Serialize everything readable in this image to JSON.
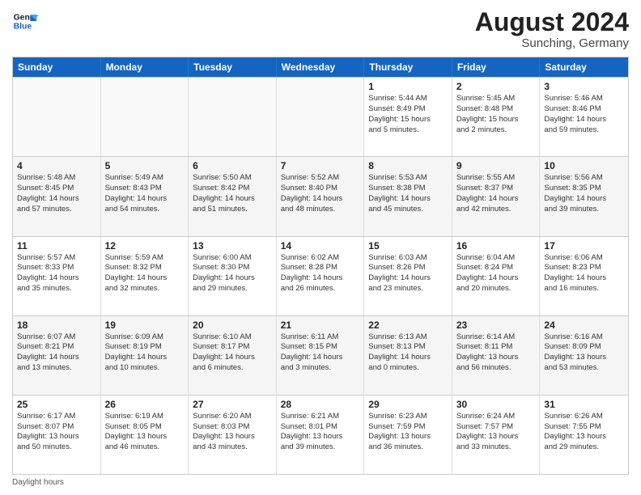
{
  "header": {
    "logo_line1": "General",
    "logo_line2": "Blue",
    "month_year": "August 2024",
    "location": "Sunching, Germany"
  },
  "days_of_week": [
    "Sunday",
    "Monday",
    "Tuesday",
    "Wednesday",
    "Thursday",
    "Friday",
    "Saturday"
  ],
  "weeks": [
    [
      {
        "day": "",
        "info": "",
        "empty": true
      },
      {
        "day": "",
        "info": "",
        "empty": true
      },
      {
        "day": "",
        "info": "",
        "empty": true
      },
      {
        "day": "",
        "info": "",
        "empty": true
      },
      {
        "day": "1",
        "info": "Sunrise: 5:44 AM\nSunset: 8:49 PM\nDaylight: 15 hours\nand 5 minutes."
      },
      {
        "day": "2",
        "info": "Sunrise: 5:45 AM\nSunset: 8:48 PM\nDaylight: 15 hours\nand 2 minutes."
      },
      {
        "day": "3",
        "info": "Sunrise: 5:46 AM\nSunset: 8:46 PM\nDaylight: 14 hours\nand 59 minutes."
      }
    ],
    [
      {
        "day": "4",
        "info": "Sunrise: 5:48 AM\nSunset: 8:45 PM\nDaylight: 14 hours\nand 57 minutes."
      },
      {
        "day": "5",
        "info": "Sunrise: 5:49 AM\nSunset: 8:43 PM\nDaylight: 14 hours\nand 54 minutes."
      },
      {
        "day": "6",
        "info": "Sunrise: 5:50 AM\nSunset: 8:42 PM\nDaylight: 14 hours\nand 51 minutes."
      },
      {
        "day": "7",
        "info": "Sunrise: 5:52 AM\nSunset: 8:40 PM\nDaylight: 14 hours\nand 48 minutes."
      },
      {
        "day": "8",
        "info": "Sunrise: 5:53 AM\nSunset: 8:38 PM\nDaylight: 14 hours\nand 45 minutes."
      },
      {
        "day": "9",
        "info": "Sunrise: 5:55 AM\nSunset: 8:37 PM\nDaylight: 14 hours\nand 42 minutes."
      },
      {
        "day": "10",
        "info": "Sunrise: 5:56 AM\nSunset: 8:35 PM\nDaylight: 14 hours\nand 39 minutes."
      }
    ],
    [
      {
        "day": "11",
        "info": "Sunrise: 5:57 AM\nSunset: 8:33 PM\nDaylight: 14 hours\nand 35 minutes."
      },
      {
        "day": "12",
        "info": "Sunrise: 5:59 AM\nSunset: 8:32 PM\nDaylight: 14 hours\nand 32 minutes."
      },
      {
        "day": "13",
        "info": "Sunrise: 6:00 AM\nSunset: 8:30 PM\nDaylight: 14 hours\nand 29 minutes."
      },
      {
        "day": "14",
        "info": "Sunrise: 6:02 AM\nSunset: 8:28 PM\nDaylight: 14 hours\nand 26 minutes."
      },
      {
        "day": "15",
        "info": "Sunrise: 6:03 AM\nSunset: 8:26 PM\nDaylight: 14 hours\nand 23 minutes."
      },
      {
        "day": "16",
        "info": "Sunrise: 6:04 AM\nSunset: 8:24 PM\nDaylight: 14 hours\nand 20 minutes."
      },
      {
        "day": "17",
        "info": "Sunrise: 6:06 AM\nSunset: 8:23 PM\nDaylight: 14 hours\nand 16 minutes."
      }
    ],
    [
      {
        "day": "18",
        "info": "Sunrise: 6:07 AM\nSunset: 8:21 PM\nDaylight: 14 hours\nand 13 minutes."
      },
      {
        "day": "19",
        "info": "Sunrise: 6:09 AM\nSunset: 8:19 PM\nDaylight: 14 hours\nand 10 minutes."
      },
      {
        "day": "20",
        "info": "Sunrise: 6:10 AM\nSunset: 8:17 PM\nDaylight: 14 hours\nand 6 minutes."
      },
      {
        "day": "21",
        "info": "Sunrise: 6:11 AM\nSunset: 8:15 PM\nDaylight: 14 hours\nand 3 minutes."
      },
      {
        "day": "22",
        "info": "Sunrise: 6:13 AM\nSunset: 8:13 PM\nDaylight: 14 hours\nand 0 minutes."
      },
      {
        "day": "23",
        "info": "Sunrise: 6:14 AM\nSunset: 8:11 PM\nDaylight: 13 hours\nand 56 minutes."
      },
      {
        "day": "24",
        "info": "Sunrise: 6:16 AM\nSunset: 8:09 PM\nDaylight: 13 hours\nand 53 minutes."
      }
    ],
    [
      {
        "day": "25",
        "info": "Sunrise: 6:17 AM\nSunset: 8:07 PM\nDaylight: 13 hours\nand 50 minutes."
      },
      {
        "day": "26",
        "info": "Sunrise: 6:19 AM\nSunset: 8:05 PM\nDaylight: 13 hours\nand 46 minutes."
      },
      {
        "day": "27",
        "info": "Sunrise: 6:20 AM\nSunset: 8:03 PM\nDaylight: 13 hours\nand 43 minutes."
      },
      {
        "day": "28",
        "info": "Sunrise: 6:21 AM\nSunset: 8:01 PM\nDaylight: 13 hours\nand 39 minutes."
      },
      {
        "day": "29",
        "info": "Sunrise: 6:23 AM\nSunset: 7:59 PM\nDaylight: 13 hours\nand 36 minutes."
      },
      {
        "day": "30",
        "info": "Sunrise: 6:24 AM\nSunset: 7:57 PM\nDaylight: 13 hours\nand 33 minutes."
      },
      {
        "day": "31",
        "info": "Sunrise: 6:26 AM\nSunset: 7:55 PM\nDaylight: 13 hours\nand 29 minutes."
      }
    ]
  ],
  "footer": {
    "label": "Daylight hours"
  }
}
